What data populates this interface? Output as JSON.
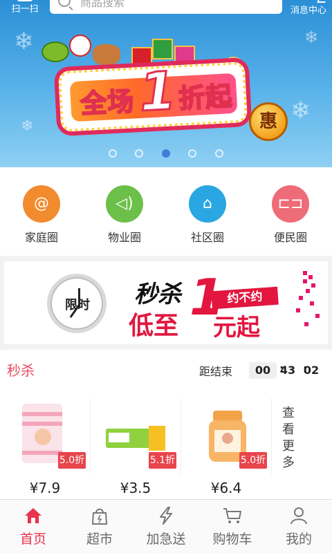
{
  "header": {
    "scan_label": "扫一扫",
    "search_placeholder": "商品搜索",
    "message_label": "消息中心"
  },
  "banner": {
    "promo_text_left": "全场",
    "promo_text_big": "1",
    "promo_text_right": "折起",
    "badge": "惠",
    "dot_count": 5,
    "active_dot": 2
  },
  "categories": [
    {
      "label": "家庭圈",
      "icon": "swirl-icon",
      "color": "#f28a2e"
    },
    {
      "label": "物业圈",
      "icon": "speaker-icon",
      "color": "#6cc04a"
    },
    {
      "label": "社区圈",
      "icon": "home-icon",
      "color": "#2aa7e2"
    },
    {
      "label": "便民圈",
      "icon": "car-icon",
      "color": "#ee6b78"
    }
  ],
  "flash_banner": {
    "clock_text": "限时",
    "line1": "秒杀",
    "big": "1",
    "tag": "约不约",
    "line2": "低至",
    "line3": "元起"
  },
  "seckill": {
    "title": "秒杀",
    "ends_label": "距结束",
    "hours": "00",
    "minutes": "43",
    "seconds": "02",
    "more_label": "查看更多",
    "products": [
      {
        "discount": "5.0折",
        "price": "¥7.9",
        "image": "towel"
      },
      {
        "discount": "5.1折",
        "price": "¥3.5",
        "image": "toothpaste"
      },
      {
        "discount": "5.0折",
        "price": "¥6.4",
        "image": "cream-jar"
      }
    ]
  },
  "tabbar": {
    "active": 0,
    "items": [
      {
        "label": "首页",
        "icon": "home-icon"
      },
      {
        "label": "超市",
        "icon": "shopping-bag-icon"
      },
      {
        "label": "加急送",
        "icon": "lightning-icon"
      },
      {
        "label": "购物车",
        "icon": "cart-icon"
      },
      {
        "label": "我的",
        "icon": "user-icon"
      }
    ]
  },
  "colors": {
    "accent": "#e8334d",
    "banner_blue": "#2b8fd6"
  }
}
